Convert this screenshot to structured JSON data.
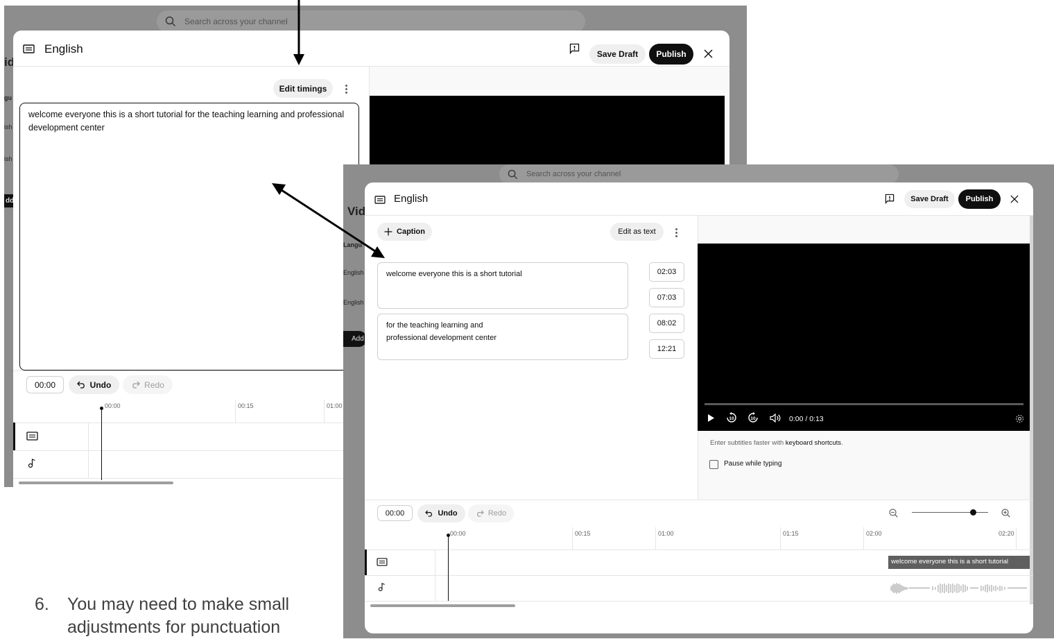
{
  "screenshot_top": {
    "search": {
      "placeholder": "Search across your channel"
    },
    "background_text": {
      "title_fragment": "id",
      "lang_fragment": "gu",
      "row1": "ish",
      "row2": "ish",
      "button_fragment": "dd"
    },
    "header": {
      "title": "English",
      "save_draft": "Save Draft",
      "publish": "Publish"
    },
    "toolbar": {
      "edit_timings": "Edit timings"
    },
    "editor": {
      "text": "welcome everyone this is a short tutorial for the teaching learning and professional development center"
    },
    "timeline_controls": {
      "time": "00:00",
      "undo": "Undo",
      "redo": "Redo"
    },
    "ruler": [
      "00:00",
      "00:15",
      "01:00"
    ]
  },
  "screenshot_front": {
    "search": {
      "placeholder": "Search across your channel"
    },
    "background_text": {
      "title_fragment": "Vid",
      "lang_fragment": "Langu",
      "row1": "English",
      "row2": "English",
      "button_fragment": "Add"
    },
    "header": {
      "title": "English",
      "save_draft": "Save Draft",
      "publish": "Publish"
    },
    "toolbar": {
      "add_caption": "Caption",
      "edit_as_text": "Edit as text"
    },
    "captions": [
      {
        "text": "welcome everyone this is a short tutorial",
        "start": "02:03",
        "end": "07:03"
      },
      {
        "text_line1": "for the teaching learning and",
        "text_line2": "professional development center",
        "start": "08:02",
        "end": "12:21"
      }
    ],
    "player": {
      "time": "0:00 / 0:13"
    },
    "hint": {
      "prefix": "Enter subtitles faster with ",
      "link": "keyboard shortcuts",
      "suffix": "."
    },
    "pause_while_typing": "Pause while typing",
    "timeline_controls": {
      "time": "00:00",
      "undo": "Undo",
      "redo": "Redo",
      "zoom_level": 0.8
    },
    "ruler": [
      "00:00",
      "00:15",
      "01:00",
      "01:15",
      "02:00",
      "02:20"
    ],
    "timeline_caption": "welcome everyone this is a short tutorial"
  },
  "instruction": {
    "number": "6.",
    "line1": "You may need to make small",
    "line2": "adjustments for punctuation"
  },
  "colors": {
    "accent_black": "#0f0f0f",
    "video_bg": "#000000",
    "panel_bg": "#f9f9f9",
    "overlay_grey": "#8d8d8d"
  }
}
